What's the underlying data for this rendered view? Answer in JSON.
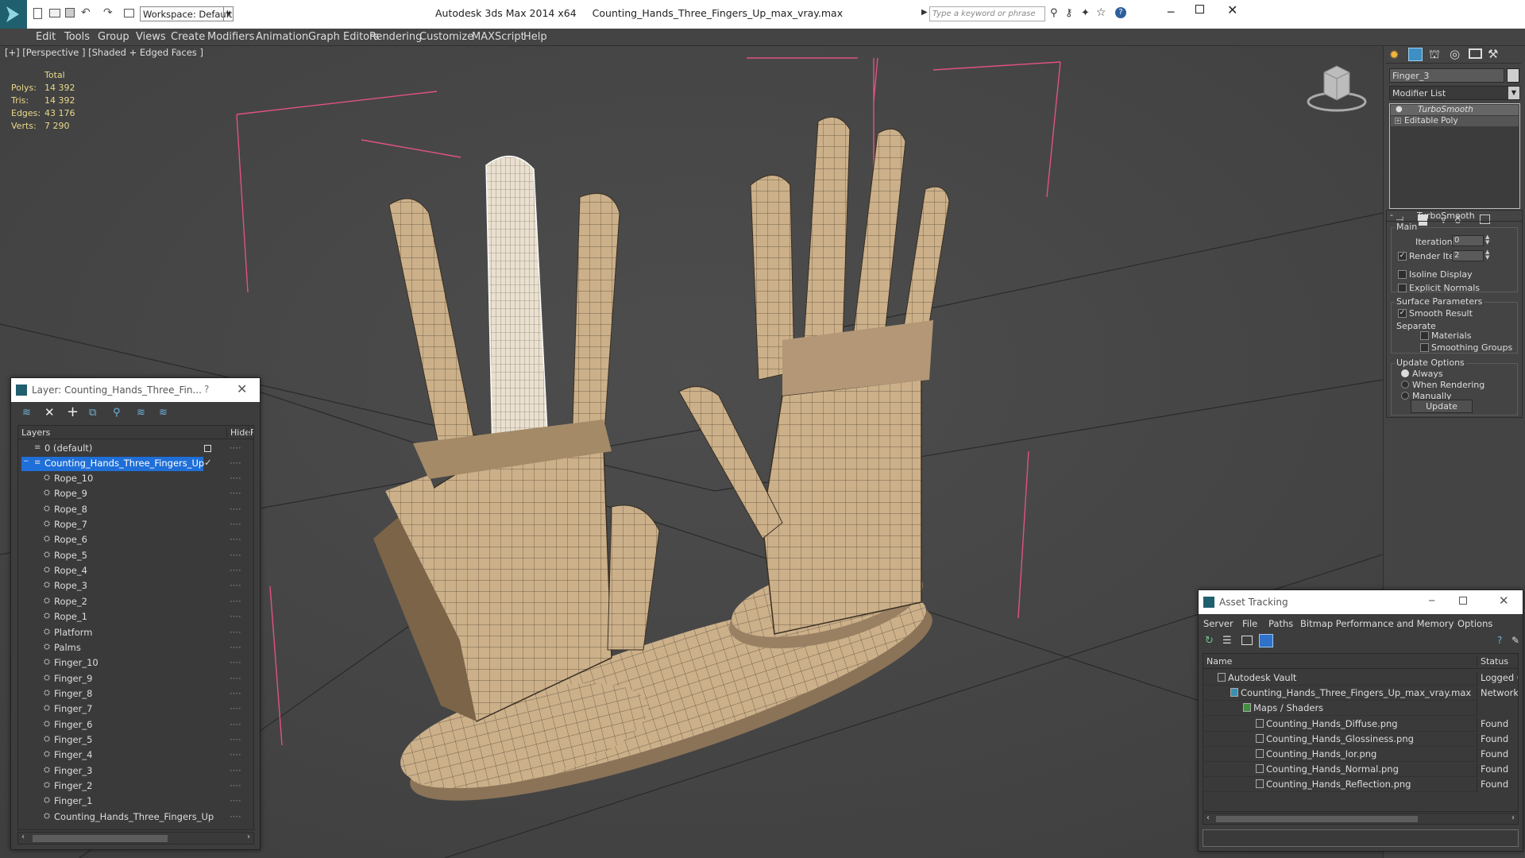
{
  "app": {
    "title": "Autodesk 3ds Max  2014 x64",
    "file": "Counting_Hands_Three_Fingers_Up_max_vray.max",
    "workspace": "Workspace: Default",
    "search_placeholder": "Type a keyword or phrase"
  },
  "menu": [
    "Edit",
    "Tools",
    "Group",
    "Views",
    "Create",
    "Modifiers",
    "Animation",
    "Graph Editors",
    "Rendering",
    "Customize",
    "MAXScript",
    "Help"
  ],
  "viewport": {
    "label": "[+] [Perspective ] [Shaded + Edged Faces ]",
    "stats": {
      "header": "Total",
      "rows": [
        {
          "label": "Polys:",
          "value": "14 392"
        },
        {
          "label": "Tris:",
          "value": "14 392"
        },
        {
          "label": "Edges:",
          "value": "43 176"
        },
        {
          "label": "Verts:",
          "value": "7 290"
        }
      ]
    }
  },
  "command_panel": {
    "object_name": "Finger_3",
    "modifier_list": "Modifier List",
    "stack": [
      "TurboSmooth",
      "Editable Poly"
    ],
    "turbosmooth": {
      "title": "TurboSmooth",
      "main": "Main",
      "iterations_label": "Iterations:",
      "iterations_value": "0",
      "render_iters_label": "Render Iters:",
      "render_iters_value": "2",
      "isoline": "Isoline Display",
      "explicit": "Explicit Normals",
      "surface_params": "Surface Parameters",
      "smooth_result": "Smooth Result",
      "separate": "Separate",
      "materials": "Materials",
      "smoothing_groups": "Smoothing Groups",
      "update_options": "Update Options",
      "always": "Always",
      "when_rendering": "When Rendering",
      "manually": "Manually",
      "update": "Update"
    }
  },
  "layer_window": {
    "title": "Layer: Counting_Hands_Three_Fin...",
    "help": "?",
    "col_layers": "Layers",
    "col_hide": "Hide",
    "col_f": "F",
    "default_layer": "0 (default)",
    "selected_layer": "Counting_Hands_Three_Fingers_Up",
    "children": [
      "Rope_10",
      "Rope_9",
      "Rope_8",
      "Rope_7",
      "Rope_6",
      "Rope_5",
      "Rope_4",
      "Rope_3",
      "Rope_2",
      "Rope_1",
      "Platform",
      "Palms",
      "Finger_10",
      "Finger_9",
      "Finger_8",
      "Finger_7",
      "Finger_6",
      "Finger_5",
      "Finger_4",
      "Finger_3",
      "Finger_2",
      "Finger_1",
      "Counting_Hands_Three_Fingers_Up"
    ]
  },
  "asset_window": {
    "title": "Asset Tracking",
    "menu": [
      "Server",
      "File",
      "Paths",
      "Bitmap Performance and Memory",
      "Options"
    ],
    "col_name": "Name",
    "col_status": "Status",
    "rows": [
      {
        "name": "Autodesk Vault",
        "status": "Logged O",
        "indent": 1
      },
      {
        "name": "Counting_Hands_Three_Fingers_Up_max_vray.max",
        "status": "Network P",
        "indent": 2
      },
      {
        "name": "Maps / Shaders",
        "status": "",
        "indent": 3
      },
      {
        "name": "Counting_Hands_Diffuse.png",
        "status": "Found",
        "indent": 4
      },
      {
        "name": "Counting_Hands_Glossiness.png",
        "status": "Found",
        "indent": 4
      },
      {
        "name": "Counting_Hands_Ior.png",
        "status": "Found",
        "indent": 4
      },
      {
        "name": "Counting_Hands_Normal.png",
        "status": "Found",
        "indent": 4
      },
      {
        "name": "Counting_Hands_Reflection.png",
        "status": "Found",
        "indent": 4
      }
    ]
  },
  "colors": {
    "selection": "#1f6fd8",
    "stats": "#e9d98a",
    "wood": "#cbb08a"
  }
}
